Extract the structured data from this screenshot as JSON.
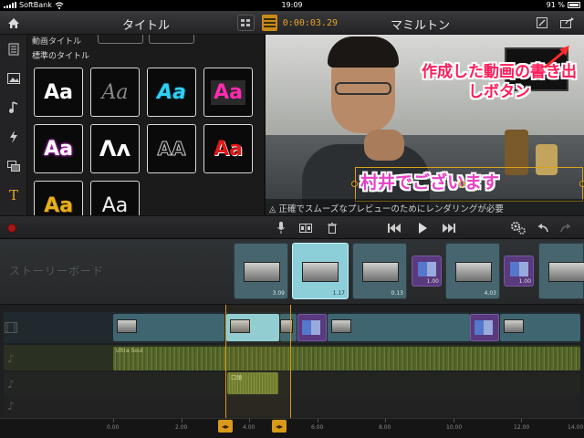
{
  "status_bar": {
    "carrier": "SoftBank",
    "time": "19:09",
    "battery": "91 %"
  },
  "toolbar": {
    "left_title": "タイトル",
    "timecode": "0:00:03.29",
    "right_title": "マミルトン",
    "icons": [
      "home-icon",
      "storyboard-grid-icon",
      "film-strip-icon",
      "edit-project-icon",
      "export-icon"
    ]
  },
  "sidebar": {
    "tools": [
      "clip-library-icon",
      "photo-icon",
      "music-note-icon",
      "transition-bolt-icon",
      "layers-icon",
      "title-t-icon"
    ]
  },
  "gallery": {
    "prev_section": "動画タイトル",
    "section": "標準のタイトル",
    "tiles": [
      {
        "text": "Aa",
        "style": "white-bold"
      },
      {
        "text": "Aa",
        "style": "script-gray"
      },
      {
        "text": "Aa",
        "style": "cyan-italic"
      },
      {
        "text": "Aa",
        "style": "magenta-box"
      },
      {
        "text": "Aa",
        "style": "white-purple-glow"
      },
      {
        "text": "Ʌʌ",
        "style": "white-curvy"
      },
      {
        "text": "AA",
        "style": "outline-black"
      },
      {
        "text": "Aa",
        "style": "red-bold"
      },
      {
        "text": "Aa",
        "style": "gold-fancy"
      },
      {
        "text": "Aa",
        "style": "white-thin"
      }
    ]
  },
  "preview": {
    "annotation": "作成した動画の書き出しボタン",
    "caption": "村井でございます",
    "notice": "正確でスムーズなプレビューのためにレンダリングが必要"
  },
  "transport": {
    "icons": [
      "record-icon",
      "microphone-icon",
      "split-icon",
      "trash-icon",
      "skip-back-icon",
      "play-icon",
      "skip-forward-icon",
      "settings-gears-icon",
      "undo-icon",
      "redo-icon"
    ]
  },
  "storyboard": {
    "label": "ストーリーボード",
    "clips": [
      {
        "type": "clip",
        "duration": "3.09"
      },
      {
        "type": "clip",
        "duration": "1.17",
        "selected": true
      },
      {
        "type": "clip",
        "duration": "0.13"
      },
      {
        "type": "transition",
        "duration": "1.00"
      },
      {
        "type": "clip",
        "duration": "4.03"
      },
      {
        "type": "transition",
        "duration": "1.00"
      },
      {
        "type": "clip",
        "duration": ""
      }
    ]
  },
  "timeline": {
    "music_label": "Ultra Soul",
    "voice_label": "口頭",
    "ruler_labels": [
      "0.00",
      "2.00",
      "4.00",
      "6.00",
      "8.00",
      "10.00",
      "12.00",
      "14.00"
    ]
  }
}
